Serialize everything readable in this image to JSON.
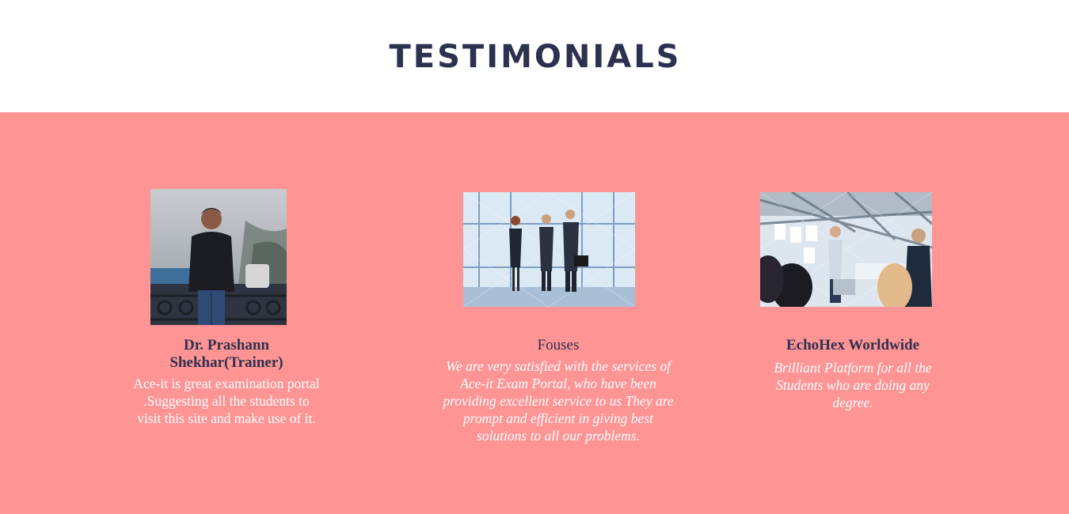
{
  "section": {
    "title": "TESTIMONIALS"
  },
  "colors": {
    "band": "#ff9494",
    "title": "#2d3150",
    "quote_text": "#ffffff"
  },
  "testimonials": [
    {
      "name": "Dr. Prashann Shekhar(Trainer)",
      "quote": "Ace-it is great examination portal .Suggesting all the students to visit this site and make use of it.",
      "photo": "portrait-photo"
    },
    {
      "name": "Fouses",
      "quote": "We are very satisfied with the services of Ace-it Exam Portal, who have been providing excellent service to us  They are prompt and efficient in giving best solutions to all our problems.",
      "photo": "business-people-photo"
    },
    {
      "name": "EchoHex Worldwide",
      "quote": "Brilliant Platform for all the Students who are doing any degree.",
      "photo": "office-presentation-photo"
    }
  ]
}
